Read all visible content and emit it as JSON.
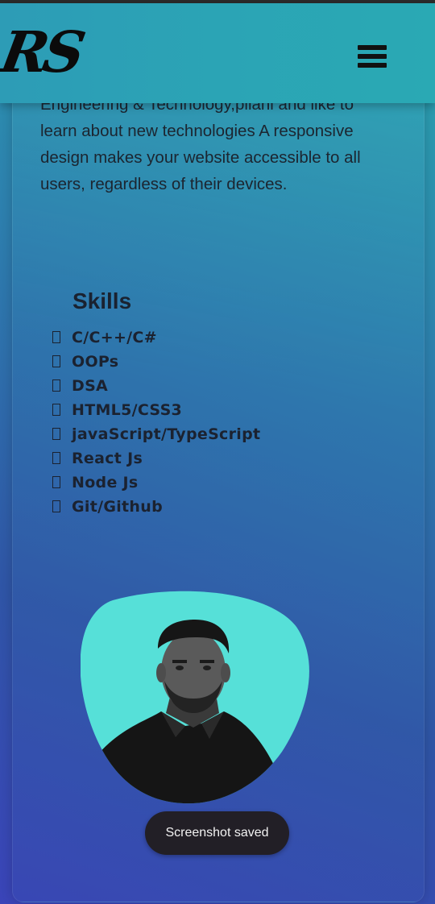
{
  "header": {
    "logo_text": "RS",
    "menu_icon": "hamburger-menu-icon"
  },
  "about": {
    "text": "Engineering & Technology,pilani and like to learn about new technologies A responsive design makes your website accessible to all users, regardless of their devices."
  },
  "skills": {
    "title": "Skills",
    "bullet_icon": "checkbox-square-icon",
    "items": [
      "C/C++/C#",
      "OOPs",
      "DSA",
      "HTML5/CSS3",
      "javaScript/TypeScript",
      "React Js",
      "Node Js",
      "Git/Github"
    ]
  },
  "profile": {
    "image": "profile-photo"
  },
  "toast": {
    "text": "Screenshot saved"
  },
  "colors": {
    "header_bg": "#2ba4b5",
    "blob": "#56e0d8",
    "text_dark": "#1c2530",
    "toast_bg": "#221f26"
  }
}
